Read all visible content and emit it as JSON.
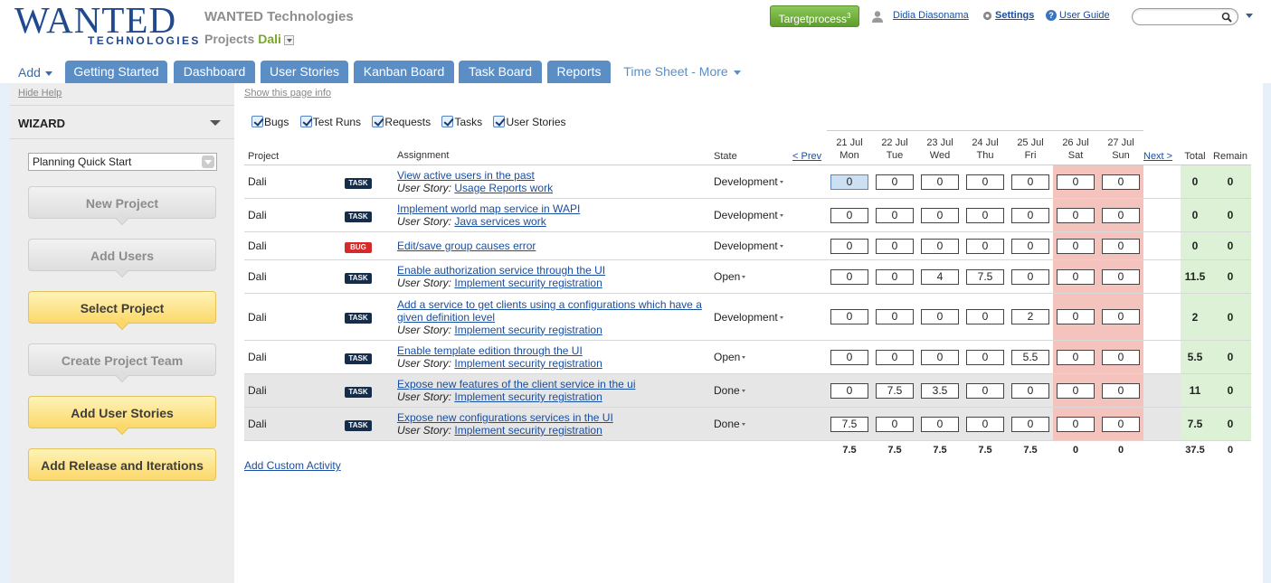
{
  "header": {
    "logo_text": "WANTED",
    "logo_sub": "TECHNOLOGIES",
    "company": "WANTED Technologies",
    "projects_label": "Projects",
    "project_name": "Dali",
    "tp_button": "Targetprocess",
    "tp_sup": "3",
    "user_name": "Didia Diasonama",
    "settings": "Settings",
    "user_guide": "User Guide",
    "search_placeholder": ""
  },
  "tabs": {
    "add": "Add",
    "items": [
      "Getting Started",
      "Dashboard",
      "User Stories",
      "Kanban Board",
      "Task Board",
      "Reports"
    ],
    "active": "Time Sheet - More"
  },
  "sidebar": {
    "hide_help": "Hide Help",
    "wizard_title": "WIZARD",
    "select_value": "Planning Quick Start",
    "steps": [
      {
        "label": "New Project",
        "state": "grey"
      },
      {
        "label": "Add Users",
        "state": "grey"
      },
      {
        "label": "Select Project",
        "state": "yellow"
      },
      {
        "label": "Create Project Team",
        "state": "grey"
      },
      {
        "label": "Add User Stories",
        "state": "yellow"
      },
      {
        "label": "Add Release and Iterations",
        "state": "yellow"
      }
    ]
  },
  "main": {
    "show_info": "Show this page info",
    "filters": [
      "Bugs",
      "Test Runs",
      "Requests",
      "Tasks",
      "User Stories"
    ],
    "add_custom_activity": "Add Custom Activity"
  },
  "table": {
    "col_project": "Project",
    "col_assignment": "Assignment",
    "col_state": "State",
    "prev": "< Prev",
    "next": "Next >",
    "col_total": "Total",
    "col_remain": "Remain",
    "days": [
      {
        "date": "21 Jul",
        "dow": "Mon"
      },
      {
        "date": "22 Jul",
        "dow": "Tue"
      },
      {
        "date": "23 Jul",
        "dow": "Wed"
      },
      {
        "date": "24 Jul",
        "dow": "Thu"
      },
      {
        "date": "25 Jul",
        "dow": "Fri"
      },
      {
        "date": "26 Jul",
        "dow": "Sat"
      },
      {
        "date": "27 Jul",
        "dow": "Sun"
      }
    ],
    "user_story_label": "User Story:",
    "rows": [
      {
        "project": "Dali",
        "type": "TASK",
        "title": "View active users in the past",
        "title2": "",
        "story": "Usage Reports work",
        "state": "Development",
        "hours": [
          "0",
          "0",
          "0",
          "0",
          "0",
          "0",
          "0"
        ],
        "total": "0",
        "remain": "0",
        "done": false
      },
      {
        "project": "Dali",
        "type": "TASK",
        "title": "Implement world map service in WAPI",
        "title2": "",
        "story": "Java services work",
        "state": "Development",
        "hours": [
          "0",
          "0",
          "0",
          "0",
          "0",
          "0",
          "0"
        ],
        "total": "0",
        "remain": "0",
        "done": false
      },
      {
        "project": "Dali",
        "type": "BUG",
        "title": "Edit/save group causes error",
        "title2": "",
        "story": "",
        "state": "Development",
        "hours": [
          "0",
          "0",
          "0",
          "0",
          "0",
          "0",
          "0"
        ],
        "total": "0",
        "remain": "0",
        "done": false
      },
      {
        "project": "Dali",
        "type": "TASK",
        "title": "Enable authorization service through the UI",
        "title2": "",
        "story": "Implement security registration",
        "state": "Open",
        "hours": [
          "0",
          "0",
          "4",
          "7.5",
          "0",
          "0",
          "0"
        ],
        "total": "11.5",
        "remain": "0",
        "done": false
      },
      {
        "project": "Dali",
        "type": "TASK",
        "title": "Add a service to get clients using a configurations which have a",
        "title2": "given definition level",
        "story": "Implement security registration",
        "state": "Development",
        "hours": [
          "0",
          "0",
          "0",
          "0",
          "2",
          "0",
          "0"
        ],
        "total": "2",
        "remain": "0",
        "done": false
      },
      {
        "project": "Dali",
        "type": "TASK",
        "title": "Enable template edition through the UI",
        "title2": "",
        "story": "Implement security registration",
        "state": "Open",
        "hours": [
          "0",
          "0",
          "0",
          "0",
          "5.5",
          "0",
          "0"
        ],
        "total": "5.5",
        "remain": "0",
        "done": false
      },
      {
        "project": "Dali",
        "type": "TASK",
        "title": "Expose new features of the client service in the ui",
        "title2": "",
        "story": "Implement security registration",
        "state": "Done",
        "hours": [
          "0",
          "7.5",
          "3.5",
          "0",
          "0",
          "0",
          "0"
        ],
        "total": "11",
        "remain": "0",
        "done": true
      },
      {
        "project": "Dali",
        "type": "TASK",
        "title": "Expose new configurations services in the UI",
        "title2": "",
        "story": "Implement security registration",
        "state": "Done",
        "hours": [
          "7.5",
          "0",
          "0",
          "0",
          "0",
          "0",
          "0"
        ],
        "total": "7.5",
        "remain": "0",
        "done": true
      }
    ],
    "totals": [
      "7.5",
      "7.5",
      "7.5",
      "7.5",
      "7.5",
      "0",
      "0"
    ],
    "grand_total": "37.5",
    "grand_remain": "0"
  }
}
